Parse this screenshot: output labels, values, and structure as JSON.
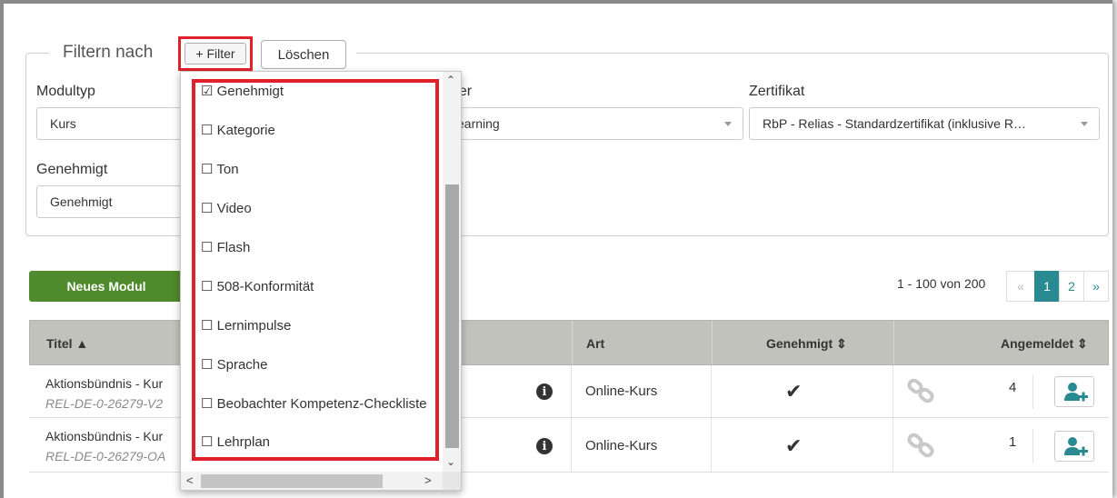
{
  "filter": {
    "legend": "Filtern nach",
    "add_filter_label": "+ Filter",
    "clear_label": "Löschen",
    "fields": {
      "modultyp": {
        "label": "Modultyp",
        "value": "Kurs"
      },
      "trainer": {
        "label_partial": "ner",
        "value_partial": "earning"
      },
      "zertifikat": {
        "label": "Zertifikat",
        "value": "RbP - Relias - Standardzertifikat (inklusive R…"
      },
      "genehmigt": {
        "label": "Genehmigt",
        "value": "Genehmigt"
      }
    }
  },
  "dropdown": {
    "items": [
      {
        "label": "Genehmigt",
        "checked": true,
        "box": "☑"
      },
      {
        "label": "Kategorie",
        "checked": false,
        "box": "☐"
      },
      {
        "label": "Ton",
        "checked": false,
        "box": "☐"
      },
      {
        "label": "Video",
        "checked": false,
        "box": "☐"
      },
      {
        "label": "Flash",
        "checked": false,
        "box": "☐"
      },
      {
        "label": "508-Konformität",
        "checked": false,
        "box": "☐"
      },
      {
        "label": "Lernimpulse",
        "checked": false,
        "box": "☐"
      },
      {
        "label": "Sprache",
        "checked": false,
        "box": "☐"
      },
      {
        "label": "Beobachter Kompetenz-Checkliste",
        "checked": false,
        "box": "☐"
      },
      {
        "label": "Lehrplan",
        "checked": false,
        "box": "☐"
      }
    ]
  },
  "toolbar": {
    "new_module_label": "Neues Modul",
    "pagination_info": "1 - 100 von 200",
    "pages": [
      "«",
      "1",
      "2",
      "»"
    ],
    "active_page": "1"
  },
  "table": {
    "headers": {
      "title": "Titel ▲",
      "art": "Art",
      "genehmigt": "Genehmigt ⇕",
      "angemeldet": "Angemeldet ⇕"
    },
    "rows": [
      {
        "title": "Aktionsbündnis - Kur",
        "code": "REL-DE-0-26279-V2",
        "art": "Online-Kurs",
        "approved": "✔",
        "count": "4"
      },
      {
        "title": "Aktionsbündnis - Kur",
        "code": "REL-DE-0-26279-OA",
        "art": "Online-Kurs",
        "approved": "✔",
        "count": "1"
      }
    ]
  },
  "colors": {
    "accent_teal": "#2a8a92",
    "button_green": "#4f8a2c",
    "highlight_red": "#e0202a",
    "header_gray": "#c2c2bd"
  }
}
